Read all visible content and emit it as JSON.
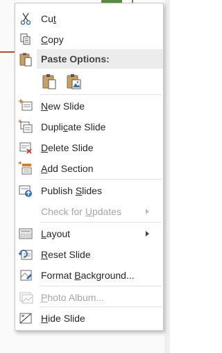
{
  "menu": {
    "items": {
      "cut": {
        "pre": "Cu",
        "key": "t",
        "post": ""
      },
      "copy": {
        "pre": "",
        "key": "C",
        "post": "opy"
      },
      "paste_header": "Paste Options:",
      "new_slide": {
        "pre": "",
        "key": "N",
        "post": "ew Slide"
      },
      "duplicate_slide": {
        "pre": "Dupli",
        "key": "c",
        "post": "ate Slide"
      },
      "delete_slide": {
        "pre": "",
        "key": "D",
        "post": "elete Slide"
      },
      "add_section": {
        "pre": "",
        "key": "A",
        "post": "dd Section"
      },
      "publish_slides": {
        "pre": "Publish ",
        "key": "S",
        "post": "lides"
      },
      "check_updates": {
        "pre": "Check for ",
        "key": "U",
        "post": "pdates"
      },
      "layout": {
        "pre": "",
        "key": "L",
        "post": "ayout"
      },
      "reset_slide": {
        "pre": "",
        "key": "R",
        "post": "eset Slide"
      },
      "format_background": {
        "pre": "Format ",
        "key": "B",
        "post": "ackground..."
      },
      "photo_album": {
        "pre": "",
        "key": "P",
        "post": "hoto Album..."
      },
      "hide_slide": {
        "pre": "",
        "key": "H",
        "post": "ide Slide"
      }
    }
  },
  "colors": {
    "accent_orange": "#e07b24",
    "accent_blue": "#2f6fb5",
    "delete_red": "#d9342b",
    "disabled_text": "#a6a6a6"
  }
}
